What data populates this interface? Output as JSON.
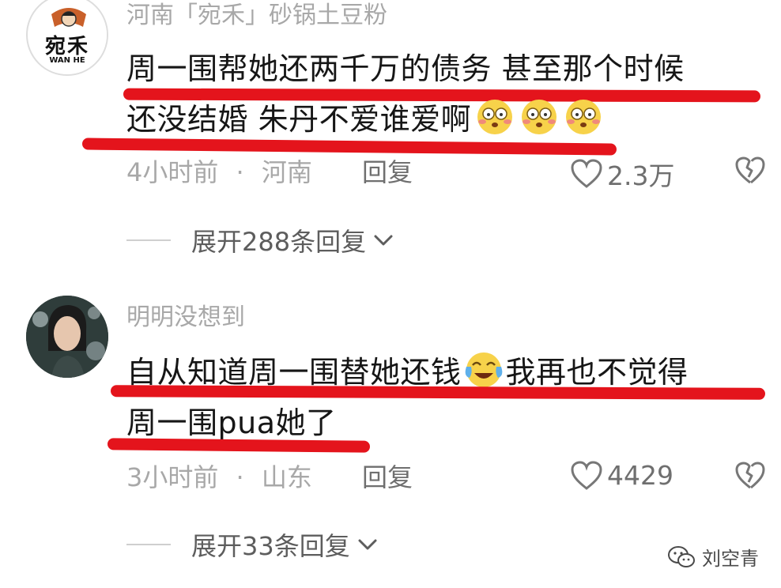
{
  "comments": [
    {
      "username": "河南「宛禾」砂锅土豆粉",
      "avatar_text": "宛禾",
      "avatar_subtext": "WAN HE",
      "line1": "周一围帮她还两千万的债务 甚至那个时候",
      "line2": "还没结婚 朱丹不爱谁爱啊",
      "time": "4小时前",
      "sep": "·",
      "location": "河南",
      "reply_label": "回复",
      "likes": "2.3万",
      "expand_label": "展开288条回复"
    },
    {
      "username": "明明没想到",
      "line1": "自从知道周一围替她还钱",
      "line1b": "我再也不觉得",
      "line2": "周一围pua她了",
      "time": "3小时前",
      "sep": "·",
      "location": "山东",
      "reply_label": "回复",
      "likes": "4429",
      "expand_label": "展开33条回复"
    }
  ],
  "watermark": {
    "text": "刘空青",
    "icon": "wechat-icon"
  },
  "colors": {
    "highlight": "#e4141c",
    "meta": "#a8a8a8",
    "text": "#161616"
  }
}
